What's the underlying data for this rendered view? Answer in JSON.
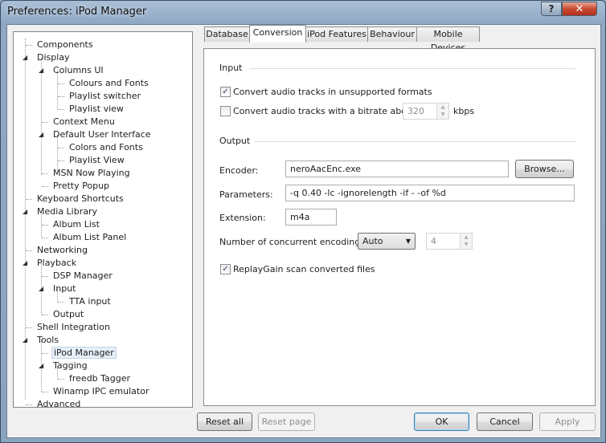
{
  "window": {
    "title": "Preferences: iPod Manager",
    "help_label": "?",
    "close_label": "✕"
  },
  "tree": {
    "items": [
      {
        "label": "Components"
      },
      {
        "label": "Display"
      },
      {
        "label": "Columns UI"
      },
      {
        "label": "Colours and Fonts"
      },
      {
        "label": "Playlist switcher"
      },
      {
        "label": "Playlist view"
      },
      {
        "label": "Context Menu"
      },
      {
        "label": "Default User Interface"
      },
      {
        "label": "Colors and Fonts"
      },
      {
        "label": "Playlist View"
      },
      {
        "label": "MSN Now Playing"
      },
      {
        "label": "Pretty Popup"
      },
      {
        "label": "Keyboard Shortcuts"
      },
      {
        "label": "Media Library"
      },
      {
        "label": "Album List"
      },
      {
        "label": "Album List Panel"
      },
      {
        "label": "Networking"
      },
      {
        "label": "Playback"
      },
      {
        "label": "DSP Manager"
      },
      {
        "label": "Input"
      },
      {
        "label": "TTA input"
      },
      {
        "label": "Output"
      },
      {
        "label": "Shell Integration"
      },
      {
        "label": "Tools"
      },
      {
        "label": "iPod Manager"
      },
      {
        "label": "Tagging"
      },
      {
        "label": "freedb Tagger"
      },
      {
        "label": "Winamp IPC emulator"
      },
      {
        "label": "Advanced"
      }
    ]
  },
  "tabs": [
    {
      "label": "Database"
    },
    {
      "label": "Conversion"
    },
    {
      "label": "iPod Features"
    },
    {
      "label": "Behaviour"
    },
    {
      "label": "Mobile Devices"
    }
  ],
  "conversion": {
    "input_group": "Input",
    "cb_unsupported": {
      "label": "Convert audio tracks in unsupported formats",
      "checked": "✓"
    },
    "cb_bitrate": {
      "label": "Convert audio tracks with a bitrate above:",
      "checked": ""
    },
    "bitrate_value": "320",
    "bitrate_unit": "kbps",
    "output_group": "Output",
    "encoder_label": "Encoder:",
    "encoder_value": "neroAacEnc.exe",
    "browse_label": "Browse...",
    "parameters_label": "Parameters:",
    "parameters_value": "-q 0.40 -lc -ignorelength -if - -of %d",
    "extension_label": "Extension:",
    "extension_value": "m4a",
    "concurrent_label": "Number of concurrent encodings:",
    "concurrent_select": "Auto",
    "concurrent_value": "4",
    "cb_replaygain": {
      "label": "ReplayGain scan converted files",
      "checked": "✓"
    }
  },
  "buttons": {
    "reset_all": "Reset all",
    "reset_page": "Reset page",
    "ok": "OK",
    "cancel": "Cancel",
    "apply": "Apply"
  }
}
